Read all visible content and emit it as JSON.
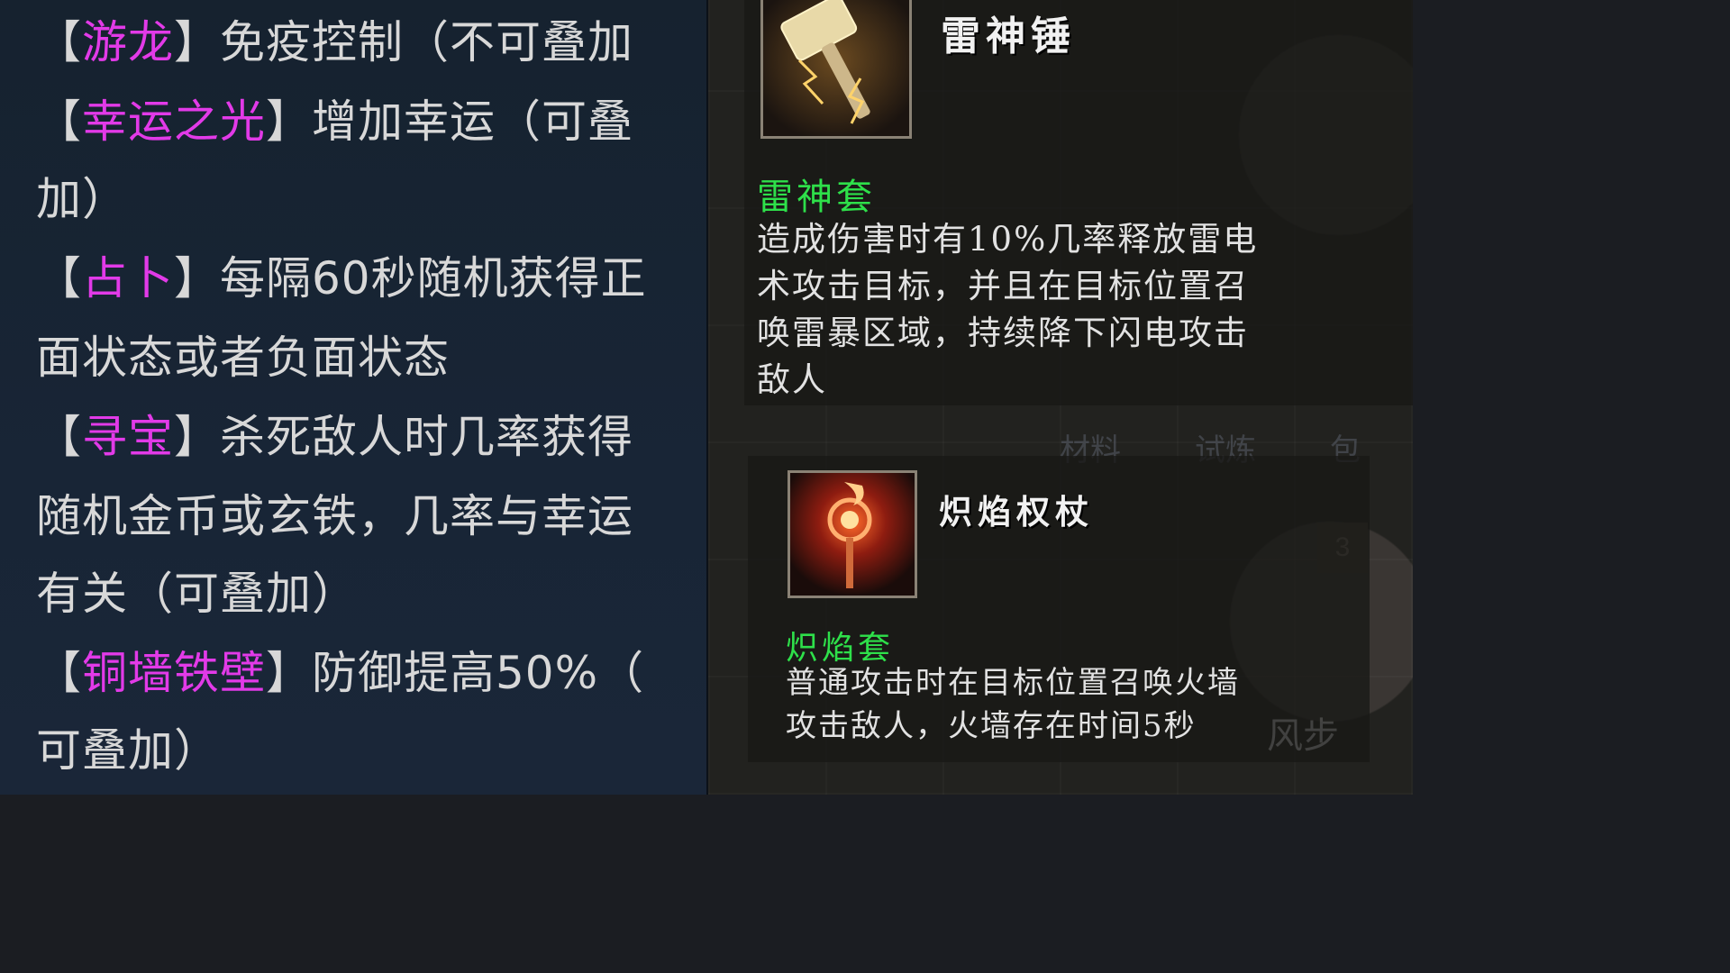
{
  "buffs": [
    {
      "name": "游龙",
      "desc": "免疫控制（不可叠加"
    },
    {
      "name": "幸运之光",
      "desc": "增加幸运（可叠",
      "cont": "加）"
    },
    {
      "name": "占卜",
      "desc": "每隔60秒随机获得正",
      "cont": "面状态或者负面状态"
    },
    {
      "name": "寻宝",
      "desc": "杀死敌人时几率获得",
      "cont": "随机金币或玄铁，几率与幸运",
      "cont2": "有关（可叠加）"
    },
    {
      "name": "铜墙铁壁",
      "desc": "防御提高50%（",
      "cont": "可叠加）"
    }
  ],
  "bracket_open": "【",
  "bracket_close": "】",
  "items": [
    {
      "name": "雷神锤",
      "icon": "thunder-hammer-icon",
      "set_name": "雷神套",
      "desc_lines": [
        "造成伤害时有10%几率释放雷电",
        "术攻击目标，并且在目标位置召",
        "唤雷暴区域，持续降下闪电攻击",
        "敌人"
      ]
    },
    {
      "name": "炽焰权杖",
      "icon": "flame-scepter-icon",
      "set_name": "炽焰套",
      "desc_lines": [
        "普通攻击时在目标位置召唤火墙",
        "攻击敌人，火墙存在时间5秒"
      ]
    }
  ],
  "background": {
    "labels": [
      "材料",
      "试炼",
      "包"
    ],
    "badge": "3",
    "skill_text": "风步"
  },
  "colors": {
    "buff_name": "#e23ae8",
    "set_name": "#2ee04a",
    "text": "#d8d8d8"
  }
}
